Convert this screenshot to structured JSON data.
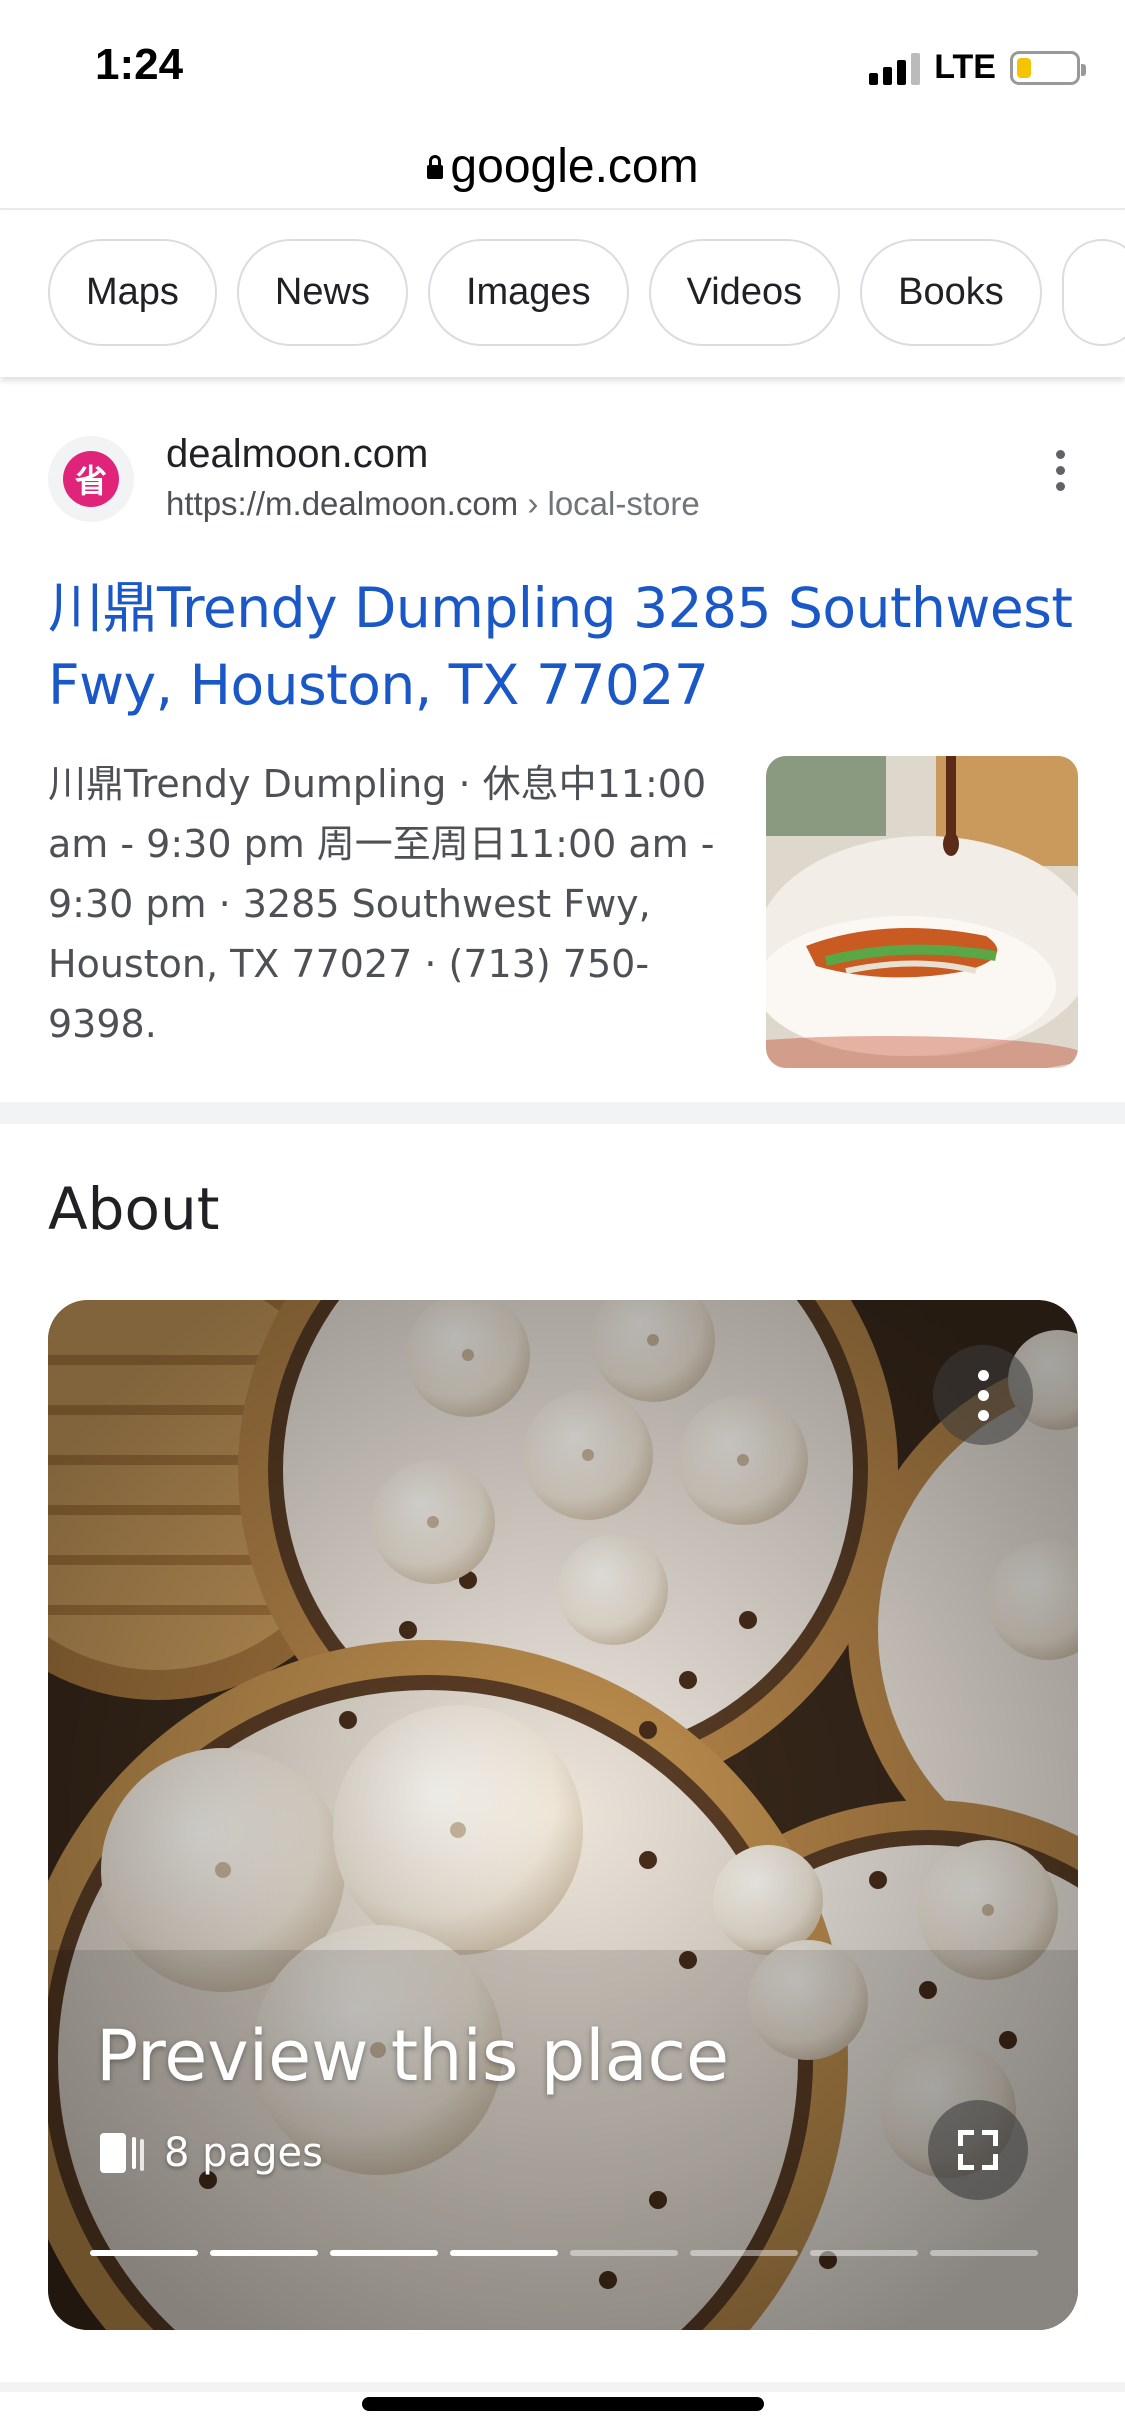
{
  "status_bar": {
    "time": "1:24",
    "network": "LTE",
    "battery_level": 0.25,
    "battery_color": "#f4c400"
  },
  "browser": {
    "url": "google.com",
    "lock_icon": "lock-icon"
  },
  "tabs": [
    "Maps",
    "News",
    "Images",
    "Videos",
    "Books"
  ],
  "result": {
    "favicon_glyph": "省",
    "favicon_color": "#e0247a",
    "site_name": "dealmoon.com",
    "site_url": "https://m.dealmoon.com",
    "site_path": " › local-store",
    "title": "川鼎Trendy Dumpling 3285 Southwest Fwy, Houston, TX 77027",
    "snippet": "川鼎Trendy Dumpling · 休息中11:00 am - 9:30 pm 周一至周日11:00 am - 9:30 pm · 3285 Southwest Fwy, Houston, TX 77027 · (713) 750-9398.",
    "link_color": "#1a57c7"
  },
  "about": {
    "heading": "About",
    "preview_title": "Preview this place",
    "pages_label": "8 pages",
    "pages_total": 8,
    "pages_viewed": 4
  }
}
